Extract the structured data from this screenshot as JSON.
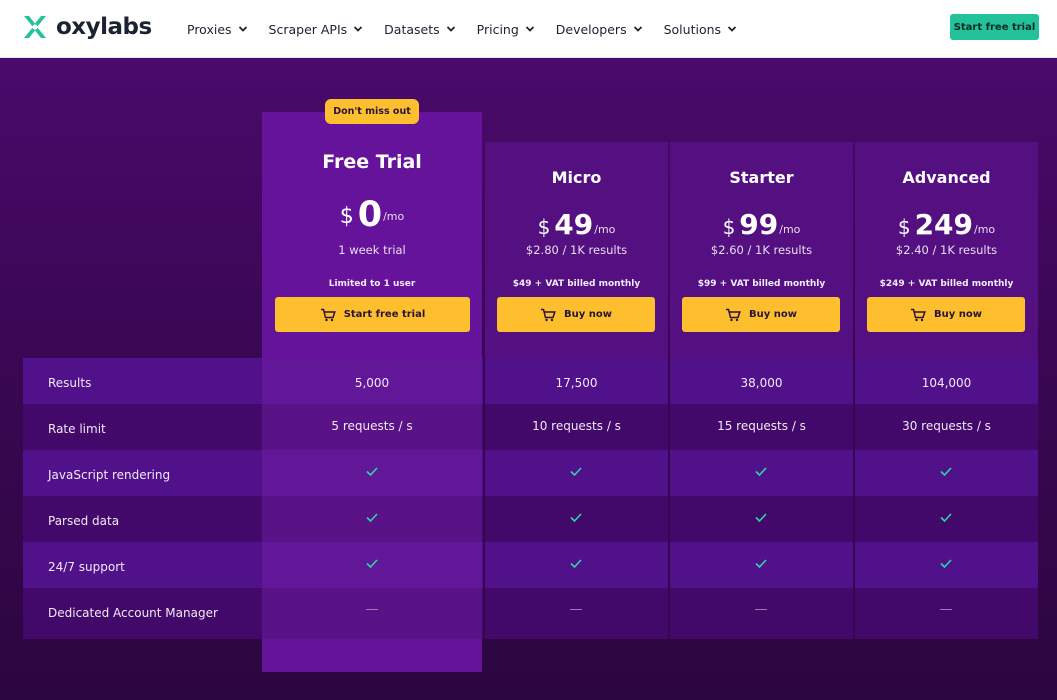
{
  "header": {
    "logo_text": "oxylabs",
    "nav": [
      {
        "label": "Proxies"
      },
      {
        "label": "Scraper APIs"
      },
      {
        "label": "Datasets"
      },
      {
        "label": "Pricing"
      },
      {
        "label": "Developers"
      },
      {
        "label": "Solutions"
      }
    ],
    "cta_label": "Start free trial"
  },
  "badge": "Don't miss out",
  "plans": [
    {
      "name": "Free Trial",
      "currency": "$",
      "price": "0",
      "per": "/mo",
      "sub": "1 week trial",
      "billing": "Limited to 1 user",
      "button": "Start free trial"
    },
    {
      "name": "Micro",
      "currency": "$",
      "price": "49",
      "per": "/mo",
      "sub": "$2.80 / 1K results",
      "billing": "$49 + VAT billed monthly",
      "button": "Buy now"
    },
    {
      "name": "Starter",
      "currency": "$",
      "price": "99",
      "per": "/mo",
      "sub": "$2.60 / 1K results",
      "billing": "$99 + VAT billed monthly",
      "button": "Buy now"
    },
    {
      "name": "Advanced",
      "currency": "$",
      "price": "249",
      "per": "/mo",
      "sub": "$2.40 / 1K results",
      "billing": "$249 + VAT billed monthly",
      "button": "Buy now"
    }
  ],
  "features": [
    {
      "label": "Results",
      "values": [
        "5,000",
        "17,500",
        "38,000",
        "104,000"
      ]
    },
    {
      "label": "Rate limit",
      "values": [
        "5 requests / s",
        "10 requests / s",
        "15 requests / s",
        "30 requests / s"
      ]
    },
    {
      "label": "JavaScript rendering",
      "values": [
        "check",
        "check",
        "check",
        "check"
      ]
    },
    {
      "label": "Parsed data",
      "values": [
        "check",
        "check",
        "check",
        "check"
      ]
    },
    {
      "label": "24/7 support",
      "values": [
        "check",
        "check",
        "check",
        "check"
      ]
    },
    {
      "label": "Dedicated Account Manager",
      "values": [
        "dash",
        "dash",
        "dash",
        "dash"
      ]
    }
  ],
  "colors": {
    "accent": "#fdbf2d",
    "brand_green": "#23c29a",
    "background": "#3a0a52",
    "check": "#2dd4a8"
  }
}
